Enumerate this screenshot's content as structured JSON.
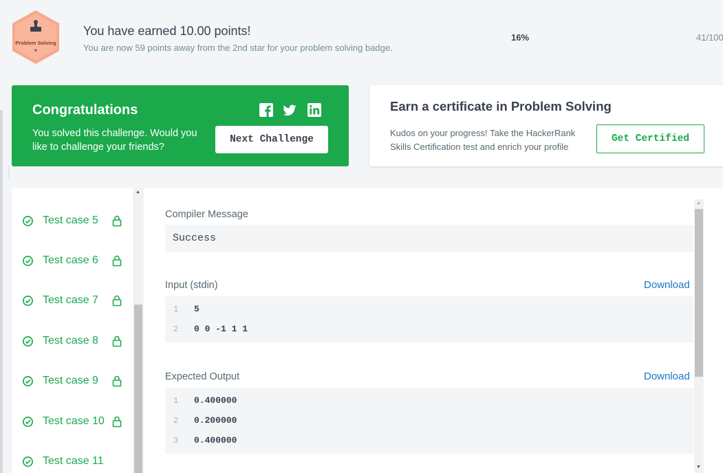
{
  "banner": {
    "badge_label": "Problem Solving",
    "badge_star": "★",
    "earned_title": "You have earned 10.00 points!",
    "earned_subtitle": "You are now 59 points away from the 2nd star for your problem solving badge.",
    "progress_percent": "16%",
    "progress_count": "41/100"
  },
  "congrats": {
    "title": "Congratulations",
    "text": "You solved this challenge. Would you like to challenge your friends?",
    "next_button": "Next Challenge",
    "social_icons": [
      "facebook-icon",
      "twitter-icon",
      "linkedin-icon"
    ]
  },
  "certificate": {
    "title": "Earn a certificate in Problem Solving",
    "text": "Kudos on your progress! Take the HackerRank Skills Certification test and enrich your profile",
    "button": "Get Certified"
  },
  "test_cases": [
    {
      "label": "Test case 5",
      "status": "passed",
      "locked": true
    },
    {
      "label": "Test case 6",
      "status": "passed",
      "locked": true
    },
    {
      "label": "Test case 7",
      "status": "passed",
      "locked": true
    },
    {
      "label": "Test case 8",
      "status": "passed",
      "locked": true
    },
    {
      "label": "Test case 9",
      "status": "passed",
      "locked": true
    },
    {
      "label": "Test case 10",
      "status": "passed",
      "locked": true
    },
    {
      "label": "Test case 11",
      "status": "passed",
      "locked": false
    }
  ],
  "output": {
    "compiler_label": "Compiler Message",
    "compiler_message": "Success",
    "input_label": "Input (stdin)",
    "input_download": "Download",
    "input_lines": [
      {
        "n": "1",
        "text": "5"
      },
      {
        "n": "2",
        "text": "0 0 -1 1 1"
      }
    ],
    "expected_label": "Expected Output",
    "expected_download": "Download",
    "expected_lines": [
      {
        "n": "1",
        "text": "0.400000"
      },
      {
        "n": "2",
        "text": "0.200000"
      },
      {
        "n": "3",
        "text": "0.400000"
      }
    ]
  },
  "colors": {
    "green": "#1ba94c",
    "badge_orange": "#f7a98c",
    "link_blue": "#1a73c9"
  }
}
